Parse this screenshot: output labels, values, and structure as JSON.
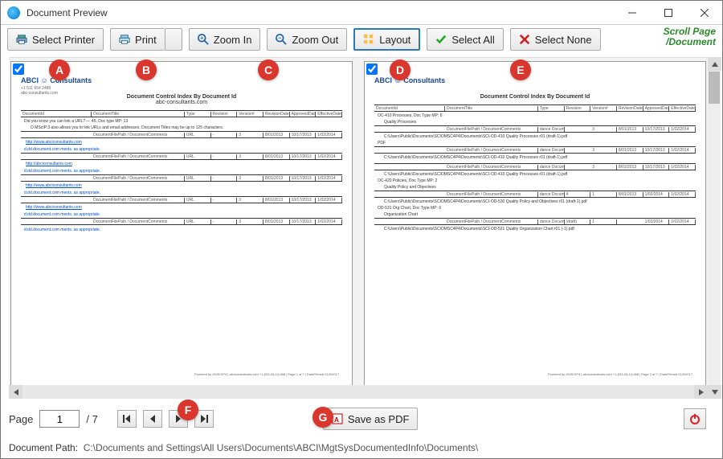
{
  "window": {
    "title": "Document Preview"
  },
  "toolbar": {
    "select_printer": "Select Printer",
    "print": "Print",
    "zoom_in": "Zoom In",
    "zoom_out": "Zoom Out",
    "layout": "Layout",
    "select_all": "Select All",
    "select_none": "Select None",
    "scroll_hint_l1": "Scroll Page",
    "scroll_hint_l2": "/Document"
  },
  "callouts": {
    "a": "A",
    "b": "B",
    "c": "C",
    "d": "D",
    "e": "E",
    "f": "F",
    "g": "G"
  },
  "pager": {
    "label": "Page",
    "current": "1",
    "total": "/ 7"
  },
  "save_pdf": "Save as PDF",
  "doc_path_label": "Document Path:",
  "doc_path_value": "C:\\Documents and Settings\\All Users\\Documents\\ABCI\\MgtSysDocumentedInfo\\Documents\\",
  "page1": {
    "logo": "ABCI ☺ Consultants",
    "phone": "+1 511 654 2489",
    "email": "abc-consultants.com",
    "title": "Document Control Index By Document Id",
    "head": [
      "DocumentId",
      "DocumentTitle",
      "Type",
      "Revision",
      "Version#",
      "RevisionDate",
      "ApprovedDate",
      "EffectiveDate"
    ],
    "sect": "Did you know you can link a URL? — 45, Doc type MP: 13",
    "note": "O MScIP:3 also allows you to link URLs and email addresses. Document Titles may be up to 125 characters.",
    "rowlbl": "DocumentFilePath / DocumentComments",
    "rowvals": [
      "URL",
      "-",
      "3",
      "8/01/2013",
      "10/17/2013",
      "1/02/2014"
    ],
    "link1": "http://www.abciconsultants.com",
    "black1": "d.dd.document.com ments. as appropriate.",
    "link2": "http://abciconsultants.com",
    "link3": "http://www.abciconsultants.com",
    "footer": "Powered by OMSCIP4 | abciconsultants.com +1-833-53-13-088 | Page 1 of 7 | DatePrinted 01/03/017"
  },
  "page2": {
    "logo": "ABCI ☺ Consultants",
    "title": "Document Control Index By Document Id",
    "sect1": "OC-410 Processes, Doc Type MP: 6",
    "sub1": "Quality Processes",
    "rowlbl": "DocumentFilePath / DocumentComments",
    "rowcat": "dance Documents",
    "rowvals": [
      "3",
      "8/01/2013",
      "10/17/2013",
      "1/02/2014"
    ],
    "path1": "C:\\Users\\Public\\Documents\\SCIOMSC4P4\\Documents\\SCI-OD-410 Quality Processes r01 (draft-1).pdf",
    "sect_pdf": "PDF",
    "sect2": "OC-420 Policies, Doc Type MP: 2",
    "sub2": "Quality Policy and Objectives",
    "rowvals2": [
      "4",
      "1",
      "8/01/2013",
      "1/02/2014",
      "1/02/2014"
    ],
    "path2": "C:\\Users\\Public\\Documents\\SCIOMSC4P4\\Documents\\SCI-OD-530 Quality Policy and Objectives r01 (draft-1).pdf",
    "sect3": "OD-531 Org Chart, Doc Type MP: 6",
    "sub3": "Organization Chart",
    "rowvals3": [
      "(draft)",
      "1",
      "",
      "1/02/2014",
      "1/02/2014"
    ],
    "path3": "C:\\Users\\Public\\Documents\\SCIOMSC4P4\\Documents\\SCI-OD-531 Quality Organization Chart r01 (-1).pdf",
    "footer": "Powered by OMSCIP4 | abciconsultants.com +1-833-53-13-088 | Page 2 of 7 | DatePrinted 01/03/017"
  }
}
